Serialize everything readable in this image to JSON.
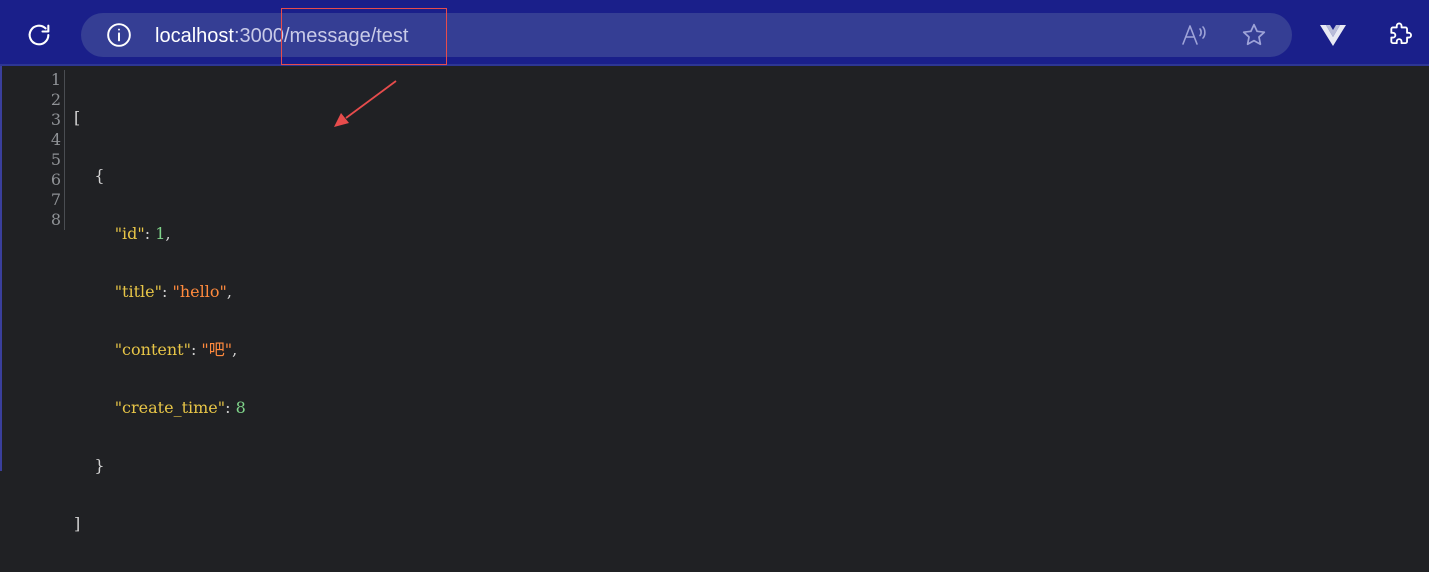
{
  "browser": {
    "url": {
      "host": "localhost",
      "rest": ":3000/message/test"
    },
    "icons": {
      "reload": "reload-icon",
      "info": "info-icon",
      "read_aloud": "read-aloud-icon",
      "favorite": "favorite-star-icon",
      "vue_devtools": "vue-devtools-icon",
      "extensions": "extensions-puzzle-icon"
    },
    "colors": {
      "toolbar": "#1a1f8a",
      "addressbar": "#353e94"
    }
  },
  "editor": {
    "line_numbers": [
      "1",
      "2",
      "3",
      "4",
      "5",
      "6",
      "7",
      "8"
    ],
    "line1": {
      "bracket": "["
    },
    "line2": {
      "brace": "{"
    },
    "line3": {
      "key": "\"id\"",
      "colon": ": ",
      "value": "1",
      "comma": ","
    },
    "line4": {
      "key": "\"title\"",
      "colon": ": ",
      "value": "\"hello\"",
      "comma": ","
    },
    "line5": {
      "key": "\"content\"",
      "colon": ": ",
      "value": "\"吧\"",
      "comma": ","
    },
    "line6": {
      "key": "\"create_time\"",
      "colon": ": ",
      "value": "8"
    },
    "line7": {
      "brace": "}"
    },
    "line8": {
      "bracket": "]"
    },
    "colors": {
      "background": "#202124",
      "key": "#e7c547",
      "string": "#ff8a3d",
      "number": "#7fd38a"
    }
  },
  "annotation": {
    "color": "#e74c4c"
  }
}
